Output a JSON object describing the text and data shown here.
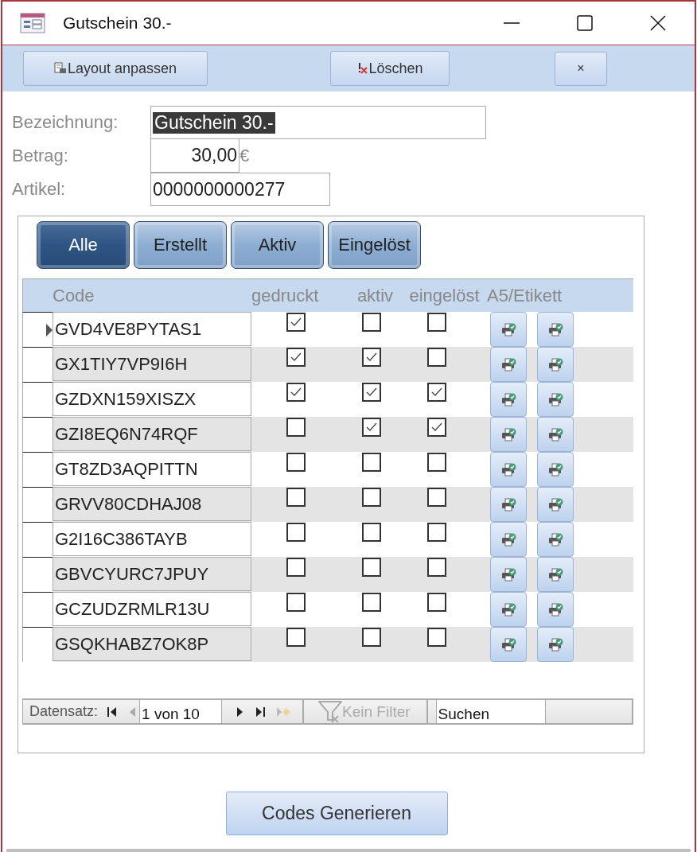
{
  "window": {
    "title": "Gutschein 30.-"
  },
  "toolbar": {
    "buttons": [
      {
        "kind": "layout",
        "label": "Layout anpassen"
      },
      {
        "kind": "delete",
        "label": "Löschen"
      },
      {
        "kind": "close",
        "label": "×"
      }
    ]
  },
  "fields": [
    {
      "kind": "highlighted",
      "label": "Bezeichnung:",
      "value": "Gutschein 30.-"
    },
    {
      "kind": "currency",
      "label": "Betrag:",
      "value": "30,00",
      "unit": "€"
    },
    {
      "kind": "plain",
      "label": "Artikel:",
      "value": "0000000000277"
    }
  ],
  "filter_tabs": [
    {
      "label": "Alle",
      "selected": true
    },
    {
      "label": "Erstellt",
      "selected": false
    },
    {
      "label": "Aktiv",
      "selected": false
    },
    {
      "label": "Eingelöst",
      "selected": false
    }
  ],
  "table": {
    "columns": [
      "Code",
      "gedruckt",
      "aktiv",
      "eingelöst",
      "A5/Etikett"
    ],
    "rows": [
      {
        "selected": true,
        "code": "GVD4VE8PYTAS1",
        "gedruckt": true,
        "aktiv": false,
        "eingeloest": false
      },
      {
        "selected": false,
        "code": "GX1TIY7VP9I6H",
        "gedruckt": true,
        "aktiv": true,
        "eingeloest": false
      },
      {
        "selected": false,
        "code": "GZDXN159XISZX",
        "gedruckt": true,
        "aktiv": true,
        "eingeloest": true
      },
      {
        "selected": false,
        "code": "GZI8EQ6N74RQF",
        "gedruckt": false,
        "aktiv": true,
        "eingeloest": true
      },
      {
        "selected": false,
        "code": "GT8ZD3AQPITTN",
        "gedruckt": false,
        "aktiv": false,
        "eingeloest": false
      },
      {
        "selected": false,
        "code": "GRVV80CDHAJ08",
        "gedruckt": false,
        "aktiv": false,
        "eingeloest": false
      },
      {
        "selected": false,
        "code": "G2I16C386TAYB",
        "gedruckt": false,
        "aktiv": false,
        "eingeloest": false
      },
      {
        "selected": false,
        "code": "GBVCYURC7JPUY",
        "gedruckt": false,
        "aktiv": false,
        "eingeloest": false
      },
      {
        "selected": false,
        "code": "GCZUDZRMLR13U",
        "gedruckt": false,
        "aktiv": false,
        "eingeloest": false
      },
      {
        "selected": false,
        "code": "GSQKHABZ7OK8P",
        "gedruckt": false,
        "aktiv": false,
        "eingeloest": false
      }
    ]
  },
  "navigation": {
    "label": "Datensatz:",
    "position": "1 von 10",
    "filter": "Kein Filter",
    "search": {
      "placeholder": "Suchen"
    }
  },
  "generate_button": "Codes Generieren"
}
